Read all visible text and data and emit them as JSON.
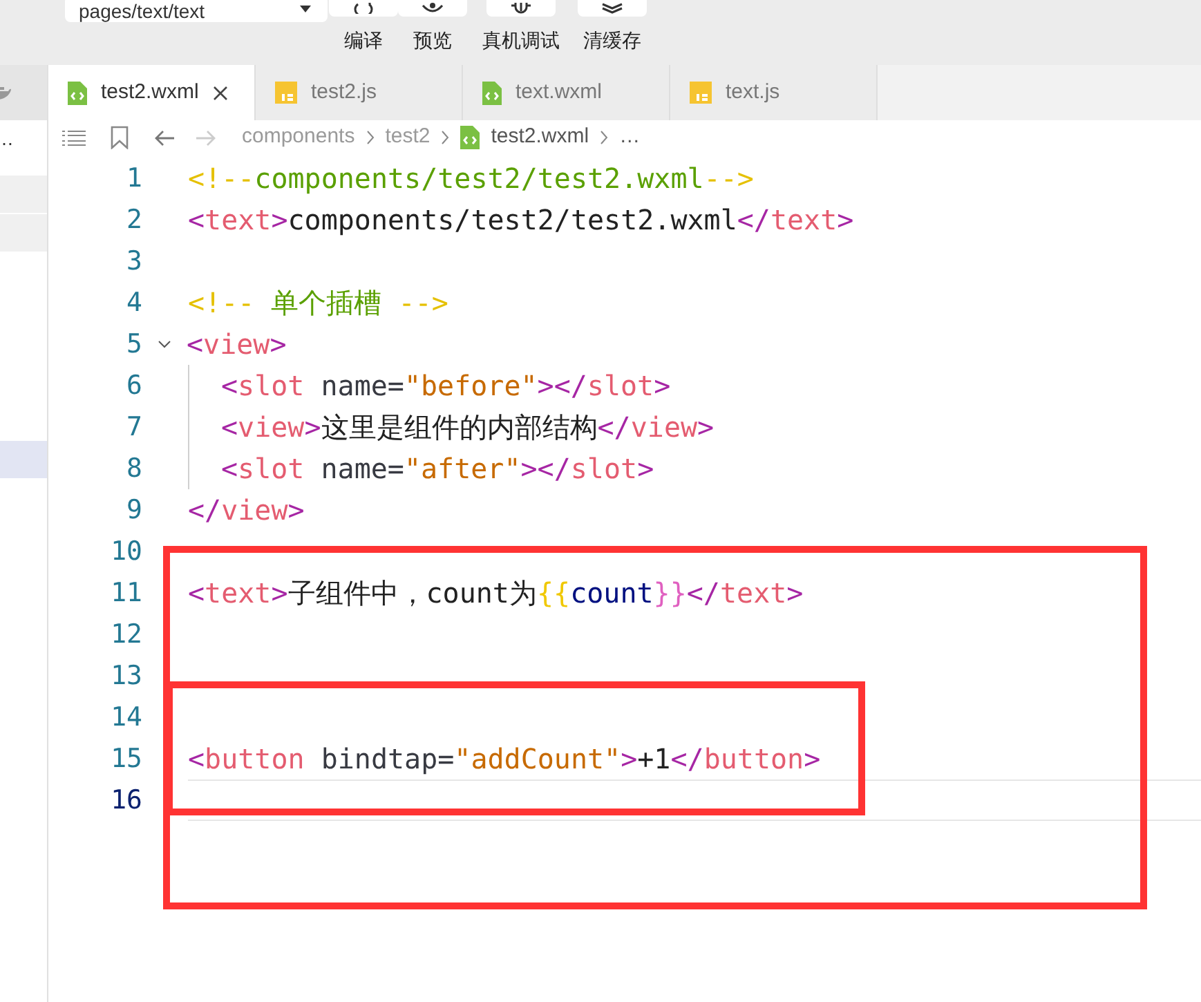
{
  "toolbar": {
    "page_select": {
      "value": "pages/text/text"
    },
    "actions": [
      {
        "label": "编译",
        "kind": "compile"
      },
      {
        "label": "预览",
        "kind": "preview"
      },
      {
        "label": "真机调试",
        "kind": "debug"
      },
      {
        "label": "清缓存",
        "kind": "cache"
      }
    ]
  },
  "sidebar": {
    "text": "…",
    "items": [
      {
        "kind": "section"
      },
      {
        "kind": "section"
      },
      {
        "kind": "highlight"
      }
    ]
  },
  "tabs": [
    {
      "label": "test2.wxml",
      "kind": "wxml",
      "selected": true
    },
    {
      "label": "test2.js",
      "kind": "js",
      "selected": false
    },
    {
      "label": "text.wxml",
      "kind": "wxml",
      "selected": false
    },
    {
      "label": "text.js",
      "kind": "js",
      "selected": false
    }
  ],
  "breadcrumb": [
    {
      "label": "components",
      "kind": "folder"
    },
    {
      "label": "test2",
      "kind": "folder"
    },
    {
      "label": "test2.wxml",
      "kind": "wxml"
    },
    {
      "label": "…",
      "kind": "more"
    }
  ],
  "editor": {
    "lines": [
      {
        "number": "1",
        "tokens": [
          {
            "text": "<!--",
            "kind": "comment-mark"
          },
          {
            "text": "components/test2/test2.wxml",
            "kind": "comment"
          },
          {
            "text": "-->",
            "kind": "comment-mark"
          }
        ]
      },
      {
        "number": "2",
        "tokens": [
          {
            "text": "<",
            "kind": "punct"
          },
          {
            "text": "text",
            "kind": "tag"
          },
          {
            "text": ">",
            "kind": "punct"
          },
          {
            "text": "components/test2/test2.wxml",
            "kind": "plain"
          },
          {
            "text": "</",
            "kind": "punct"
          },
          {
            "text": "text",
            "kind": "tag"
          },
          {
            "text": ">",
            "kind": "punct"
          }
        ]
      },
      {
        "number": "3"
      },
      {
        "number": "4",
        "tokens": [
          {
            "text": "<!--",
            "kind": "comment-mark"
          },
          {
            "text": " 单个插槽 ",
            "kind": "comment"
          },
          {
            "text": "-->",
            "kind": "comment-mark"
          }
        ]
      },
      {
        "number": "5",
        "fold": true,
        "tokens": [
          {
            "text": "<",
            "kind": "punct"
          },
          {
            "text": "view",
            "kind": "tag"
          },
          {
            "text": ">",
            "kind": "punct"
          }
        ]
      },
      {
        "number": "6",
        "indent": true,
        "tokens": [
          {
            "text": "<",
            "kind": "punct"
          },
          {
            "text": "slot",
            "kind": "tag"
          },
          {
            "text": " name=",
            "kind": "attr"
          },
          {
            "text": "\"before\"",
            "kind": "string"
          },
          {
            "text": "></",
            "kind": "punct"
          },
          {
            "text": "slot",
            "kind": "tag"
          },
          {
            "text": ">",
            "kind": "punct"
          }
        ]
      },
      {
        "number": "7",
        "indent": true,
        "tokens": [
          {
            "text": "<",
            "kind": "punct"
          },
          {
            "text": "view",
            "kind": "tag"
          },
          {
            "text": ">",
            "kind": "punct"
          },
          {
            "text": "这里是组件的内部结构",
            "kind": "plain"
          },
          {
            "text": "</",
            "kind": "punct"
          },
          {
            "text": "view",
            "kind": "tag"
          },
          {
            "text": ">",
            "kind": "punct"
          }
        ]
      },
      {
        "number": "8",
        "indent": true,
        "tokens": [
          {
            "text": "<",
            "kind": "punct"
          },
          {
            "text": "slot",
            "kind": "tag"
          },
          {
            "text": " name=",
            "kind": "attr"
          },
          {
            "text": "\"after\"",
            "kind": "string"
          },
          {
            "text": "></",
            "kind": "punct"
          },
          {
            "text": "slot",
            "kind": "tag"
          },
          {
            "text": ">",
            "kind": "punct"
          }
        ]
      },
      {
        "number": "9",
        "tokens": [
          {
            "text": "</",
            "kind": "punct"
          },
          {
            "text": "view",
            "kind": "tag"
          },
          {
            "text": ">",
            "kind": "punct"
          }
        ]
      },
      {
        "number": "10"
      },
      {
        "number": "11",
        "tokens": [
          {
            "text": "<",
            "kind": "punct"
          },
          {
            "text": "text",
            "kind": "tag"
          },
          {
            "text": ">",
            "kind": "punct"
          },
          {
            "text": "子组件中，count为",
            "kind": "plain"
          },
          {
            "text": "{{",
            "kind": "brace-open"
          },
          {
            "text": "count",
            "kind": "variable"
          },
          {
            "text": "}}",
            "kind": "brace-close"
          },
          {
            "text": "</",
            "kind": "punct"
          },
          {
            "text": "text",
            "kind": "tag"
          },
          {
            "text": ">",
            "kind": "punct"
          }
        ]
      },
      {
        "number": "12"
      },
      {
        "number": "13"
      },
      {
        "number": "14"
      },
      {
        "number": "15",
        "tokens": [
          {
            "text": "<",
            "kind": "punct"
          },
          {
            "text": "button",
            "kind": "tag"
          },
          {
            "text": " bindtap=",
            "kind": "attr"
          },
          {
            "text": "\"addCount\"",
            "kind": "string"
          },
          {
            "text": ">",
            "kind": "punct"
          },
          {
            "text": "+1",
            "kind": "plain"
          },
          {
            "text": "</",
            "kind": "punct"
          },
          {
            "text": "button",
            "kind": "tag"
          },
          {
            "text": ">",
            "kind": "punct"
          }
        ]
      },
      {
        "number": "16",
        "current": true
      }
    ]
  },
  "annotations": {
    "outer_frame": true,
    "inner_frame": true
  }
}
